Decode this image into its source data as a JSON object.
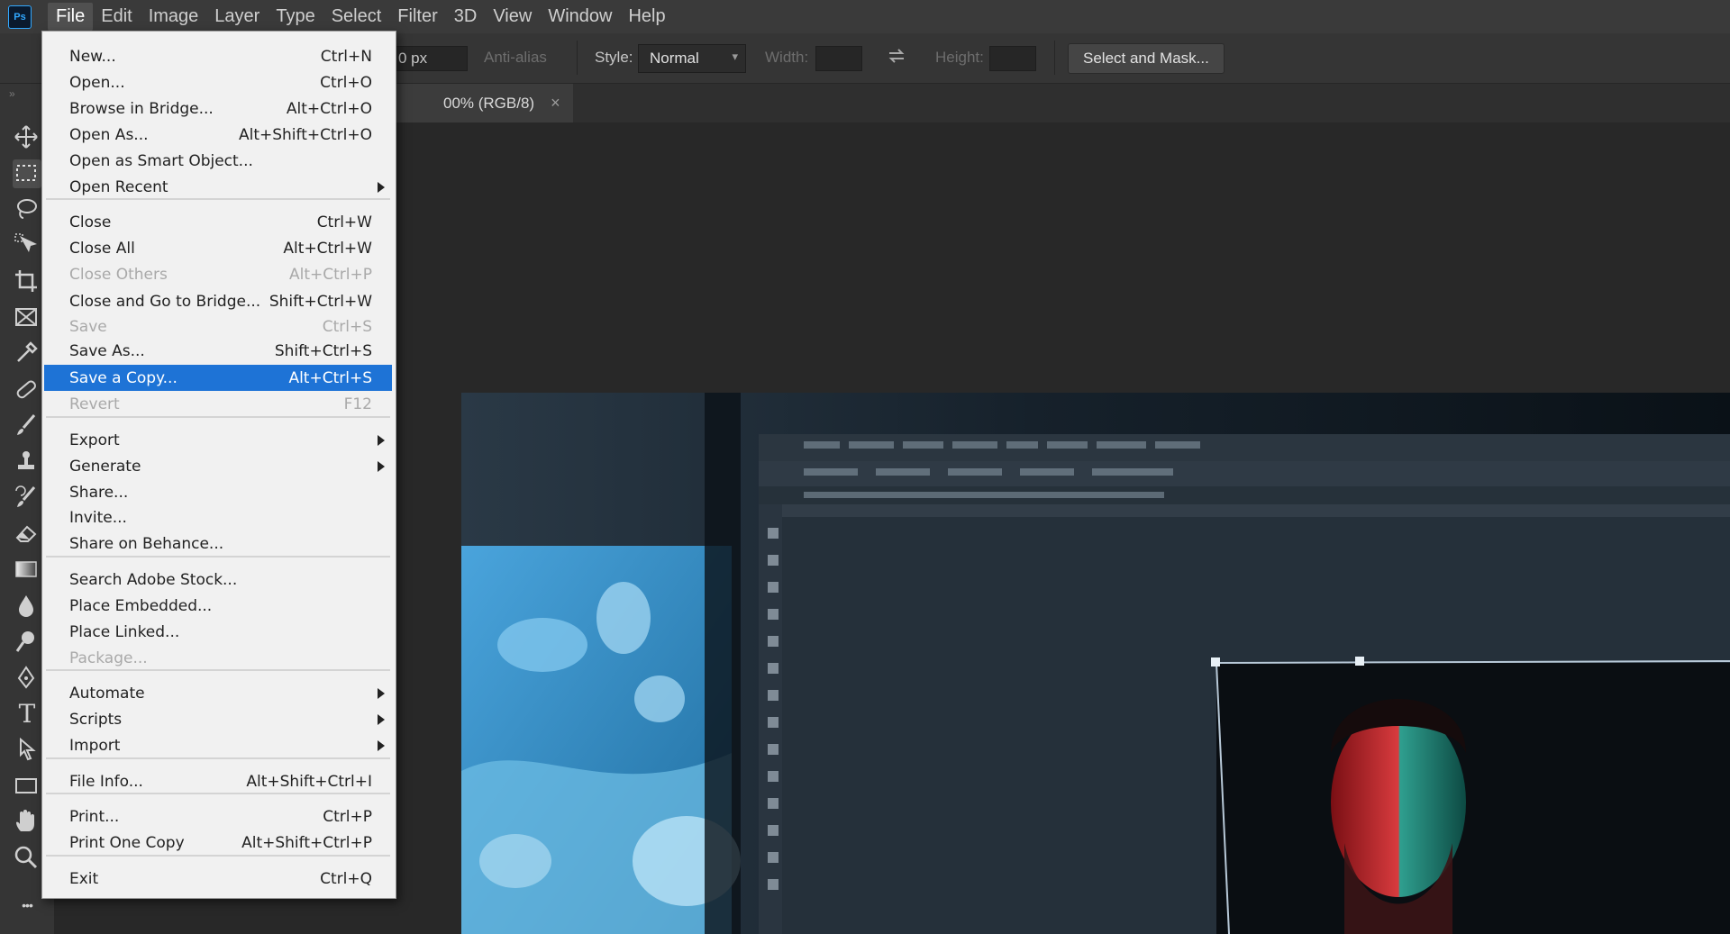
{
  "app": {
    "logo_text": "Ps"
  },
  "menubar": {
    "items": [
      "File",
      "Edit",
      "Image",
      "Layer",
      "Type",
      "Select",
      "Filter",
      "3D",
      "View",
      "Window",
      "Help"
    ],
    "active": "File"
  },
  "options_bar": {
    "feather_value": "0 px",
    "anti_alias_label": "Anti-alias",
    "style_label": "Style:",
    "style_value": "Normal",
    "width_label": "Width:",
    "height_label": "Height:",
    "select_mask_label": "Select and Mask..."
  },
  "document_tab": {
    "title_partial": "00% (RGB/8)",
    "close_glyph": "×"
  },
  "toolbar": {
    "tools": [
      "move-tool",
      "marquee-tool",
      "lasso-tool",
      "object-select-tool",
      "crop-tool",
      "frame-tool",
      "eyedropper-tool",
      "healing-tool",
      "brush-tool",
      "stamp-tool",
      "history-brush-tool",
      "eraser-tool",
      "gradient-tool",
      "blur-tool",
      "dodge-tool",
      "pen-tool",
      "type-tool",
      "path-select-tool",
      "rectangle-tool",
      "hand-tool",
      "zoom-tool",
      "more-tools"
    ],
    "selected": "marquee-tool",
    "type_tool_glyph": "T",
    "more_glyph": "•••"
  },
  "file_menu": {
    "items": [
      {
        "label": "New...",
        "shortcut": "Ctrl+N"
      },
      {
        "label": "Open...",
        "shortcut": "Ctrl+O"
      },
      {
        "label": "Browse in Bridge...",
        "shortcut": "Alt+Ctrl+O"
      },
      {
        "label": "Open As...",
        "shortcut": "Alt+Shift+Ctrl+O"
      },
      {
        "label": "Open as Smart Object...",
        "shortcut": ""
      },
      {
        "label": "Open Recent",
        "shortcut": "",
        "submenu": true
      },
      {
        "label": "Close",
        "shortcut": "Ctrl+W"
      },
      {
        "label": "Close All",
        "shortcut": "Alt+Ctrl+W"
      },
      {
        "label": "Close Others",
        "shortcut": "Alt+Ctrl+P",
        "disabled": true
      },
      {
        "label": "Close and Go to Bridge...",
        "shortcut": "Shift+Ctrl+W"
      },
      {
        "label": "Save",
        "shortcut": "Ctrl+S",
        "disabled": true
      },
      {
        "label": "Save As...",
        "shortcut": "Shift+Ctrl+S"
      },
      {
        "label": "Save a Copy...",
        "shortcut": "Alt+Ctrl+S",
        "highlighted": true
      },
      {
        "label": "Revert",
        "shortcut": "F12",
        "disabled": true
      },
      {
        "label": "Export",
        "shortcut": "",
        "submenu": true
      },
      {
        "label": "Generate",
        "shortcut": "",
        "submenu": true
      },
      {
        "label": "Share...",
        "shortcut": ""
      },
      {
        "label": "Invite...",
        "shortcut": ""
      },
      {
        "label": "Share on Behance...",
        "shortcut": ""
      },
      {
        "label": "Search Adobe Stock...",
        "shortcut": ""
      },
      {
        "label": "Place Embedded...",
        "shortcut": ""
      },
      {
        "label": "Place Linked...",
        "shortcut": ""
      },
      {
        "label": "Package...",
        "shortcut": "",
        "disabled": true
      },
      {
        "label": "Automate",
        "shortcut": "",
        "submenu": true
      },
      {
        "label": "Scripts",
        "shortcut": "",
        "submenu": true
      },
      {
        "label": "Import",
        "shortcut": "",
        "submenu": true
      },
      {
        "label": "File Info...",
        "shortcut": "Alt+Shift+Ctrl+I"
      },
      {
        "label": "Print...",
        "shortcut": "Ctrl+P"
      },
      {
        "label": "Print One Copy",
        "shortcut": "Alt+Shift+Ctrl+P"
      },
      {
        "label": "Exit",
        "shortcut": "Ctrl+Q"
      }
    ]
  }
}
